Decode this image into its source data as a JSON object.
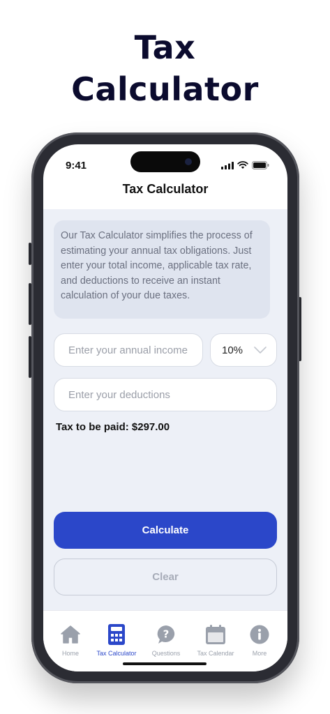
{
  "headline": {
    "line1": "Tax",
    "line2": "Calculator"
  },
  "status_bar": {
    "time": "9:41"
  },
  "screen": {
    "title": "Tax Calculator",
    "info_text": "Our Tax Calculator simplifies the process of estimating your annual tax obligations. Just enter your total income, applicable tax rate, and deductions to receive an instant calculation of your due taxes.",
    "income_input": {
      "placeholder": "Enter your annual income",
      "value": ""
    },
    "rate_select": {
      "selected": "10%"
    },
    "deductions_input": {
      "placeholder": "Enter your deductions",
      "value": ""
    },
    "result_text": "Tax to be paid: $297.00",
    "calculate_label": "Calculate",
    "clear_label": "Clear"
  },
  "tabbar": {
    "items": [
      {
        "label": "Home",
        "icon": "home-icon"
      },
      {
        "label": "Tax Calculator",
        "icon": "calculator-icon",
        "active": true
      },
      {
        "label": "Questions",
        "icon": "question-icon"
      },
      {
        "label": "Tax Calendar",
        "icon": "calendar-icon"
      },
      {
        "label": "More",
        "icon": "info-icon"
      }
    ]
  },
  "colors": {
    "accent": "#2b47c9",
    "background": "#edf0f7",
    "headline": "#0b0b2e"
  }
}
